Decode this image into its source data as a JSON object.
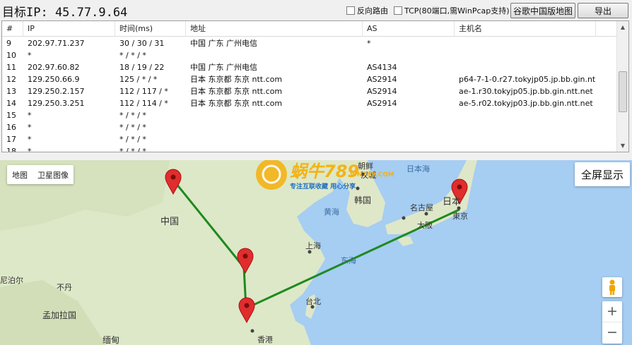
{
  "toolbar": {
    "target_ip": "目标IP: 45.77.9.64",
    "reverse_route_label": "反向路由",
    "tcp_label": "TCP(80端口,需WinPcap支持)",
    "google_china_map_button": "谷歌中国版地图",
    "export_button": "导出"
  },
  "table": {
    "headers": [
      "#",
      "IP",
      "时间(ms)",
      "地址",
      "AS",
      "主机名"
    ],
    "rows": [
      {
        "num": "9",
        "ip": "202.97.71.237",
        "time": "30 / 30 / 31",
        "addr": "中国 广东 广州电信",
        "as": "*",
        "host": ""
      },
      {
        "num": "10",
        "ip": "*",
        "time": "* / * / *",
        "addr": "",
        "as": "",
        "host": ""
      },
      {
        "num": "11",
        "ip": "202.97.60.82",
        "time": "18 / 19 / 22",
        "addr": "中国 广东 广州电信",
        "as": "AS4134",
        "host": ""
      },
      {
        "num": "12",
        "ip": "129.250.66.9",
        "time": "125 / * / *",
        "addr": "日本 东京都 东京 ntt.com",
        "as": "AS2914",
        "host": "p64-7-1-0.r27.tokyjp05.jp.bb.gin.nt..."
      },
      {
        "num": "13",
        "ip": "129.250.2.157",
        "time": "112 / 117 / *",
        "addr": "日本 东京都 东京 ntt.com",
        "as": "AS2914",
        "host": "ae-1.r30.tokyjp05.jp.bb.gin.ntt.net"
      },
      {
        "num": "14",
        "ip": "129.250.3.251",
        "time": "112 / 114 / *",
        "addr": "日本 东京都 东京 ntt.com",
        "as": "AS2914",
        "host": "ae-5.r02.tokyjp03.jp.bb.gin.ntt.net"
      },
      {
        "num": "15",
        "ip": "*",
        "time": "* / * / *",
        "addr": "",
        "as": "",
        "host": ""
      },
      {
        "num": "16",
        "ip": "*",
        "time": "* / * / *",
        "addr": "",
        "as": "",
        "host": ""
      },
      {
        "num": "17",
        "ip": "*",
        "time": "* / * / *",
        "addr": "",
        "as": "",
        "host": ""
      },
      {
        "num": "18",
        "ip": "*",
        "time": "* / * / *",
        "addr": "",
        "as": "",
        "host": ""
      }
    ]
  },
  "map": {
    "type_map": "地图",
    "type_satellite": "卫星图像",
    "fullscreen_button": "全屏显示",
    "zoom_in": "+",
    "zoom_out": "−",
    "place_labels": [
      "中国",
      "日本海",
      "韩国",
      "黄海",
      "上海",
      "东海",
      "台北",
      "香港",
      "名古屋",
      "大阪",
      "東京",
      "日本",
      "尼泊尔",
      "不丹",
      "孟加拉国",
      "缅甸",
      "朝鲜",
      "汉城"
    ],
    "watermark_title": "蜗牛789",
    "watermark_sub": "专注互联收藏  用心分享",
    "watermark_site": "WN789.COM",
    "route_color": "#1e8a1e",
    "marker_color": "#e02d2d"
  }
}
